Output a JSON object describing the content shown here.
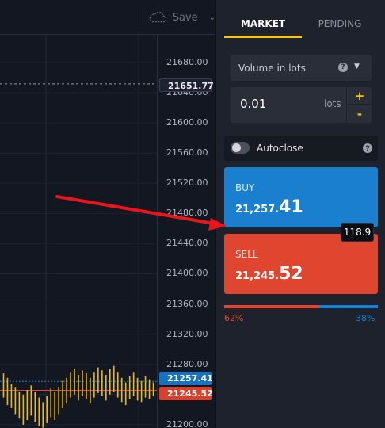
{
  "toolbar": {
    "save_label": "Save",
    "save_icon": "cloud-icon",
    "chevron_icon": "chevron-down-icon"
  },
  "price_axis": {
    "ticks": [
      "21680.00",
      "21640.00",
      "21600.00",
      "21560.00",
      "21520.00",
      "21480.00",
      "21440.00",
      "21400.00",
      "21360.00",
      "21320.00",
      "21280.00",
      "21240.00",
      "21200.00"
    ],
    "tick_values": [
      21680,
      21640,
      21600,
      21560,
      21520,
      21480,
      21440,
      21400,
      21360,
      21320,
      21280,
      21240,
      21200
    ],
    "last_price": "21651.77",
    "ask_price": "21257.41",
    "bid_price": "21245.52"
  },
  "chart": {
    "candle_color": "#e8b923",
    "ask_line_color": "#1a7fcf",
    "bid_line_color": "#e0452f",
    "last_line_color": "#9aa0ab",
    "candles": [
      {
        "h": 21268,
        "l": 21236
      },
      {
        "h": 21262,
        "l": 21226
      },
      {
        "h": 21254,
        "l": 21222
      },
      {
        "h": 21250,
        "l": 21214
      },
      {
        "h": 21244,
        "l": 21208
      },
      {
        "h": 21240,
        "l": 21200
      },
      {
        "h": 21246,
        "l": 21206
      },
      {
        "h": 21252,
        "l": 21212
      },
      {
        "h": 21244,
        "l": 21204
      },
      {
        "h": 21236,
        "l": 21198
      },
      {
        "h": 21230,
        "l": 21196
      },
      {
        "h": 21238,
        "l": 21202
      },
      {
        "h": 21248,
        "l": 21210
      },
      {
        "h": 21244,
        "l": 21206
      },
      {
        "h": 21250,
        "l": 21214
      },
      {
        "h": 21258,
        "l": 21222
      },
      {
        "h": 21262,
        "l": 21228
      },
      {
        "h": 21270,
        "l": 21236
      },
      {
        "h": 21274,
        "l": 21240
      },
      {
        "h": 21266,
        "l": 21232
      },
      {
        "h": 21272,
        "l": 21238
      },
      {
        "h": 21268,
        "l": 21234
      },
      {
        "h": 21262,
        "l": 21228
      },
      {
        "h": 21270,
        "l": 21236
      },
      {
        "h": 21276,
        "l": 21242
      },
      {
        "h": 21272,
        "l": 21238
      },
      {
        "h": 21266,
        "l": 21232
      },
      {
        "h": 21274,
        "l": 21240
      },
      {
        "h": 21278,
        "l": 21244
      },
      {
        "h": 21270,
        "l": 21236
      },
      {
        "h": 21262,
        "l": 21230
      },
      {
        "h": 21256,
        "l": 21226
      },
      {
        "h": 21264,
        "l": 21234
      },
      {
        "h": 21270,
        "l": 21238
      },
      {
        "h": 21262,
        "l": 21232
      },
      {
        "h": 21258,
        "l": 21230
      },
      {
        "h": 21264,
        "l": 21236
      },
      {
        "h": 21260,
        "l": 21234
      },
      {
        "h": 21256,
        "l": 21238
      }
    ]
  },
  "tabs": {
    "market": "MARKET",
    "pending": "PENDING"
  },
  "order": {
    "volume_label": "Volume in lots",
    "volume_help_icon": "question-circle-icon",
    "dropdown_icon": "caret-down-icon",
    "lots_value": "0.01",
    "lots_unit": "lots",
    "plus_label": "+",
    "minus_label": "-",
    "autoclose_label": "Autoclose",
    "autoclose_on": false,
    "autoclose_help_icon": "question-circle-icon"
  },
  "buy": {
    "label": "BUY",
    "price_main": "21,257.",
    "price_big": "41",
    "color": "#1a7fcf"
  },
  "sell": {
    "label": "SELL",
    "price_main": "21,245.",
    "price_big": "52",
    "color": "#e0452f"
  },
  "spread": "118.9",
  "sentiment": {
    "sell_pct": "62%",
    "buy_pct": "38%",
    "sell_fraction": 0.62
  },
  "annotation": {
    "arrow_color": "#e8161b"
  }
}
